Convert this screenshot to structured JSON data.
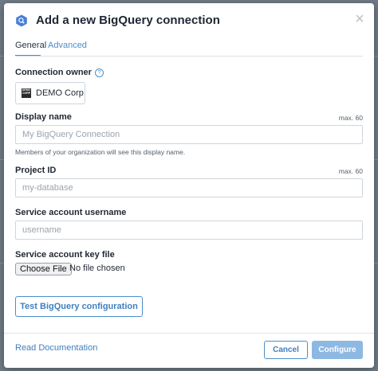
{
  "dialog": {
    "title": "Add a new BigQuery connection",
    "close_label": "×"
  },
  "tabs": [
    {
      "label": "General",
      "active": true
    },
    {
      "label": "Advanced",
      "active": false
    }
  ],
  "owner": {
    "label": "Connection owner",
    "help_glyph": "?",
    "logo_text": "DEMO CORP",
    "name": "DEMO Corp"
  },
  "display_name": {
    "label": "Display name",
    "max": "max. 60",
    "value": "",
    "placeholder": "My BigQuery Connection",
    "hint": "Members of your organization will see this display name."
  },
  "project_id": {
    "label": "Project ID",
    "max": "max. 60",
    "value": "",
    "placeholder": "my-database"
  },
  "service_username": {
    "label": "Service account username",
    "value": "",
    "placeholder": "username"
  },
  "key_file": {
    "label": "Service account key file",
    "button_label": "Choose File",
    "status": "No file chosen"
  },
  "actions": {
    "test_label": "Test BigQuery configuration",
    "doc_link": "Read Documentation",
    "cancel_label": "Cancel",
    "configure_label": "Configure"
  },
  "colors": {
    "accent": "#4d8ec8",
    "primary_disabled": "#8db8e2",
    "backdrop": "#7b8791"
  },
  "icons": {
    "logo": "bigquery-logo-icon",
    "close": "close-icon",
    "help": "help-icon"
  }
}
